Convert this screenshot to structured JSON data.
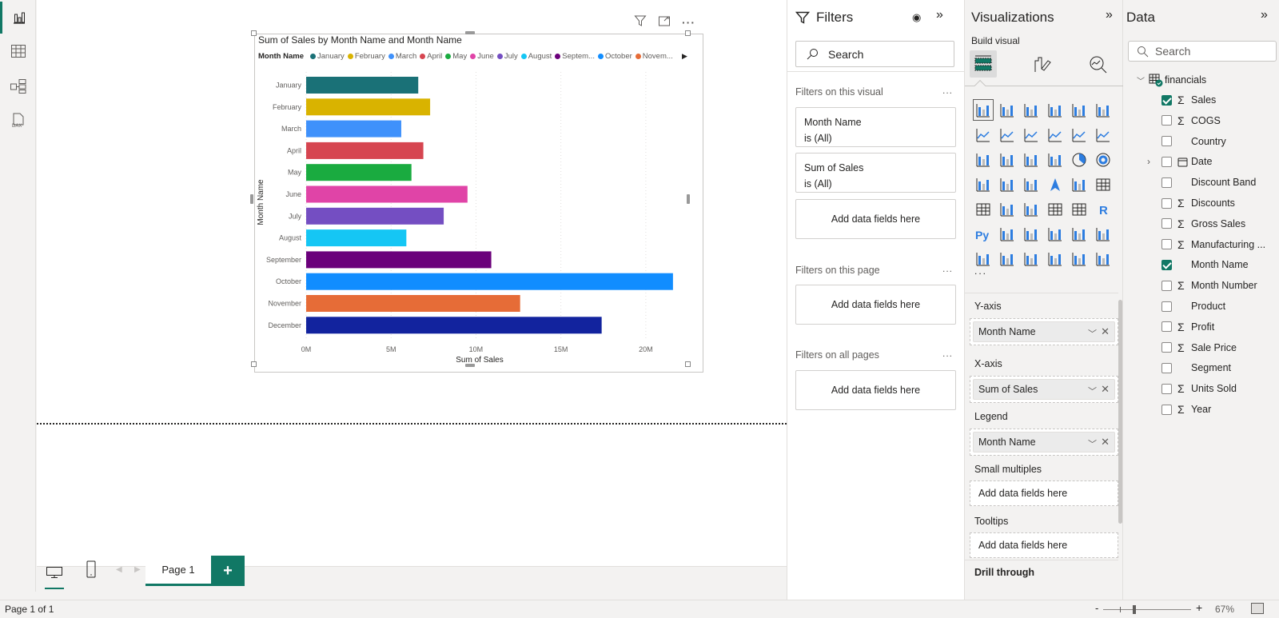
{
  "left_nav": [
    {
      "name": "report-view",
      "icon": "bar-chart-icon",
      "active": true
    },
    {
      "name": "table-view",
      "icon": "table-icon",
      "active": false
    },
    {
      "name": "model-view",
      "icon": "model-icon",
      "active": false
    },
    {
      "name": "dax-query-view",
      "icon": "dax-icon",
      "active": false
    }
  ],
  "visual": {
    "title": "Sum of Sales by Month Name and Month Name",
    "legend_title": "Month Name",
    "legend_items": [
      {
        "label": "January",
        "color": "#1a7177"
      },
      {
        "label": "February",
        "color": "#d9b300"
      },
      {
        "label": "March",
        "color": "#3f91fb"
      },
      {
        "label": "April",
        "color": "#d64550"
      },
      {
        "label": "May",
        "color": "#1aab40"
      },
      {
        "label": "June",
        "color": "#e044a7"
      },
      {
        "label": "July",
        "color": "#744ec2"
      },
      {
        "label": "August",
        "color": "#15c6f4"
      },
      {
        "label": "Septem...",
        "color": "#6b007b"
      },
      {
        "label": "October",
        "color": "#118dff"
      },
      {
        "label": "Novem...",
        "color": "#e66c37"
      }
    ],
    "header_icons": [
      "filter-icon",
      "focus-mode-icon",
      "more-options-icon"
    ]
  },
  "chart_data": {
    "type": "bar",
    "orientation": "horizontal",
    "title": "Sum of Sales by Month Name and Month Name",
    "xlabel": "Sum of Sales",
    "ylabel": "Month Name",
    "categories": [
      "January",
      "February",
      "March",
      "April",
      "May",
      "June",
      "July",
      "August",
      "September",
      "October",
      "November",
      "December"
    ],
    "values": [
      6.6,
      7.3,
      5.6,
      6.9,
      6.2,
      9.5,
      8.1,
      5.9,
      10.9,
      21.6,
      12.6,
      17.4
    ],
    "value_unit": "M",
    "colors": [
      "#1a7177",
      "#d9b300",
      "#3f91fb",
      "#d64550",
      "#1aab40",
      "#e044a7",
      "#744ec2",
      "#15c6f4",
      "#6b007b",
      "#118dff",
      "#e66c37",
      "#12239e"
    ],
    "xticks": [
      0,
      5,
      10,
      15,
      20
    ],
    "xtick_labels": [
      "0M",
      "5M",
      "10M",
      "15M",
      "20M"
    ],
    "xlim": [
      0,
      21.7
    ],
    "grid": true,
    "legend_position": "top"
  },
  "filters": {
    "title": "Filters",
    "search_placeholder": "Search",
    "on_visual_label": "Filters on this visual",
    "on_visual_cards": [
      {
        "field": "Month Name",
        "state": "is (All)"
      },
      {
        "field": "Sum of Sales",
        "state": "is (All)"
      }
    ],
    "add_fields": "Add data fields here",
    "on_page_label": "Filters on this page",
    "on_all_pages_label": "Filters on all pages",
    "more": "..."
  },
  "visualizations": {
    "title": "Visualizations",
    "subtitle": "Build visual",
    "tabs": [
      "build-visual-tab",
      "format-visual-tab",
      "analytics-tab"
    ],
    "more": "...",
    "wells": [
      {
        "label": "Y-axis",
        "value": "Month Name"
      },
      {
        "label": "X-axis",
        "value": "Sum of Sales"
      },
      {
        "label": "Legend",
        "value": "Month Name"
      },
      {
        "label": "Small multiples",
        "value": null,
        "placeholder": "Add data fields here"
      },
      {
        "label": "Tooltips",
        "value": null,
        "placeholder": "Add data fields here"
      }
    ],
    "drill_through": "Drill through"
  },
  "data": {
    "title": "Data",
    "search_placeholder": "Search",
    "table": "financials",
    "fields": [
      {
        "name": "Sales",
        "sigma": true,
        "checked": true
      },
      {
        "name": "COGS",
        "sigma": true,
        "checked": false
      },
      {
        "name": "Country",
        "sigma": false,
        "checked": false
      },
      {
        "name": "Date",
        "sigma": false,
        "checked": false,
        "calendar": true,
        "expandable": true
      },
      {
        "name": "Discount Band",
        "sigma": false,
        "checked": false
      },
      {
        "name": "Discounts",
        "sigma": true,
        "checked": false
      },
      {
        "name": "Gross Sales",
        "sigma": true,
        "checked": false
      },
      {
        "name": "Manufacturing ...",
        "sigma": true,
        "checked": false
      },
      {
        "name": "Month Name",
        "sigma": false,
        "checked": true
      },
      {
        "name": "Month Number",
        "sigma": true,
        "checked": false
      },
      {
        "name": "Product",
        "sigma": false,
        "checked": false
      },
      {
        "name": "Profit",
        "sigma": true,
        "checked": false
      },
      {
        "name": "Sale Price",
        "sigma": true,
        "checked": false
      },
      {
        "name": "Segment",
        "sigma": false,
        "checked": false
      },
      {
        "name": "Units Sold",
        "sigma": true,
        "checked": false
      },
      {
        "name": "Year",
        "sigma": true,
        "checked": false
      }
    ]
  },
  "pages": {
    "tabs": [
      {
        "label": "Page 1",
        "active": true
      }
    ],
    "add_label": "+"
  },
  "status": {
    "page_info": "Page 1 of 1",
    "zoom": "67%",
    "zoom_fraction": 0.35
  }
}
